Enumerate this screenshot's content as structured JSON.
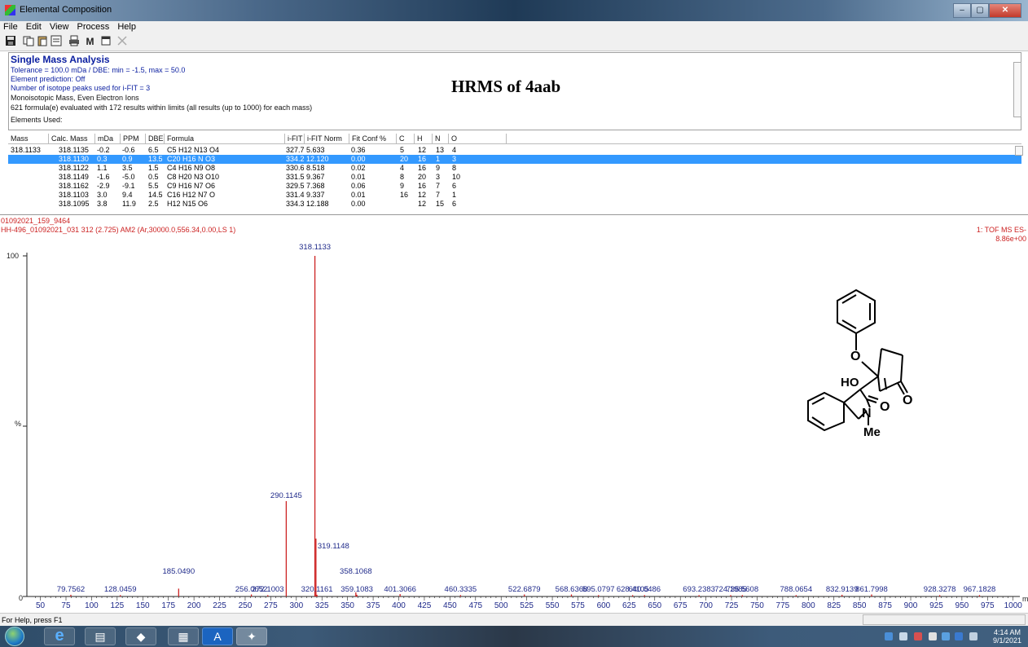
{
  "window": {
    "title": "Elemental Composition",
    "buttons": {
      "minimize": "–",
      "maximize": "▢",
      "close": "✕"
    }
  },
  "menu": [
    "File",
    "Edit",
    "View",
    "Process",
    "Help"
  ],
  "toolbar": {
    "m_label": "M"
  },
  "summary": {
    "title": "Single Mass Analysis",
    "tolerance": "Tolerance = 100.0 mDa  /  DBE: min = -1.5, max = 50.0",
    "element_prediction": "Element prediction: Off",
    "isotope_peaks": "Number of isotope peaks used for i-FIT = 3",
    "ion_type": "Monoisotopic Mass, Even Electron Ions",
    "formula_count": "621 formula(e) evaluated with 172 results within limits (all results (up to 1000) for each mass)",
    "elements_used": "Elements Used:",
    "annotation": "HRMS of 4aab"
  },
  "results": {
    "columns": [
      "Mass",
      "Calc. Mass",
      "mDa",
      "PPM",
      "DBE",
      "Formula",
      "i-FIT",
      "i-FIT Norm",
      "Fit Conf %",
      "C",
      "H",
      "N",
      "O"
    ],
    "rows": [
      {
        "mass": "318.1133",
        "calc": "318.1135",
        "mda": "-0.2",
        "ppm": "-0.6",
        "dbe": "6.5",
        "formula": "C5 H12 N13 O4",
        "ifit": "327.7",
        "ifitnorm": "5.633",
        "conf": "0.36",
        "c": "5",
        "h": "12",
        "n": "13",
        "o": "4"
      },
      {
        "mass": "",
        "calc": "318.1130",
        "mda": "0.3",
        "ppm": "0.9",
        "dbe": "13.5",
        "formula": "C20 H16 N O3",
        "ifit": "334.2",
        "ifitnorm": "12.120",
        "conf": "0.00",
        "c": "20",
        "h": "16",
        "n": "1",
        "o": "3"
      },
      {
        "mass": "",
        "calc": "318.1122",
        "mda": "1.1",
        "ppm": "3.5",
        "dbe": "1.5",
        "formula": "C4 H16 N9 O8",
        "ifit": "330.6",
        "ifitnorm": "8.518",
        "conf": "0.02",
        "c": "4",
        "h": "16",
        "n": "9",
        "o": "8"
      },
      {
        "mass": "",
        "calc": "318.1149",
        "mda": "-1.6",
        "ppm": "-5.0",
        "dbe": "0.5",
        "formula": "C8 H20 N3 O10",
        "ifit": "331.5",
        "ifitnorm": "9.367",
        "conf": "0.01",
        "c": "8",
        "h": "20",
        "n": "3",
        "o": "10"
      },
      {
        "mass": "",
        "calc": "318.1162",
        "mda": "-2.9",
        "ppm": "-9.1",
        "dbe": "5.5",
        "formula": "C9 H16 N7 O6",
        "ifit": "329.5",
        "ifitnorm": "7.368",
        "conf": "0.06",
        "c": "9",
        "h": "16",
        "n": "7",
        "o": "6"
      },
      {
        "mass": "",
        "calc": "318.1103",
        "mda": "3.0",
        "ppm": "9.4",
        "dbe": "14.5",
        "formula": "C16 H12 N7 O",
        "ifit": "331.4",
        "ifitnorm": "9.337",
        "conf": "0.01",
        "c": "16",
        "h": "12",
        "n": "7",
        "o": "1"
      },
      {
        "mass": "",
        "calc": "318.1095",
        "mda": "3.8",
        "ppm": "11.9",
        "dbe": "2.5",
        "formula": "H12 N15 O6",
        "ifit": "334.3",
        "ifitnorm": "12.188",
        "conf": "0.00",
        "c": "",
        "h": "12",
        "n": "15",
        "o": "6"
      }
    ],
    "selected_row": 1
  },
  "spectrum_header": {
    "sample_id": "01092021_159_9464",
    "scan_info": "HH-496_01092021_031 312 (2.725) AM2 (Ar,30000.0,556.34,0.00,LS 1)",
    "mode": "1: TOF MS ES-",
    "intensity": "8.86e+00",
    "y_top_label": "100",
    "y_mid_label": "%",
    "y_zero_label": "0",
    "x_unit": "m"
  },
  "chart_data": {
    "type": "bar",
    "xlim": [
      40,
      1005
    ],
    "ylim": [
      0,
      100
    ],
    "x_ticks": [
      50,
      75,
      100,
      125,
      150,
      175,
      200,
      225,
      250,
      275,
      300,
      325,
      350,
      375,
      400,
      425,
      450,
      475,
      500,
      525,
      550,
      575,
      600,
      625,
      650,
      675,
      700,
      725,
      750,
      775,
      800,
      825,
      850,
      875,
      900,
      925,
      950,
      975,
      1000
    ],
    "peaks": [
      {
        "mz": 79.7562,
        "label": "79.7562",
        "rel": 0.5
      },
      {
        "mz": 128.0459,
        "label": "128.0459",
        "rel": 0.4
      },
      {
        "mz": 185.049,
        "label": "185.0490",
        "rel": 2.3
      },
      {
        "mz": 256.0652,
        "label": "256.0652",
        "rel": 0.6
      },
      {
        "mz": 272.1003,
        "label": "272.1003",
        "rel": 0.4
      },
      {
        "mz": 290.1145,
        "label": "290.1145",
        "rel": 28
      },
      {
        "mz": 318.1133,
        "label": "318.1133",
        "rel": 100
      },
      {
        "mz": 319.1148,
        "label": "319.1148",
        "rel": 17
      },
      {
        "mz": 320.1161,
        "label": "320.1161",
        "rel": 0.5
      },
      {
        "mz": 358.1068,
        "label": "358.1068",
        "rel": 1.2
      },
      {
        "mz": 359.1083,
        "label": "359.1083",
        "rel": 0.5
      },
      {
        "mz": 401.3066,
        "label": "401.3066",
        "rel": 0.7
      },
      {
        "mz": 460.3335,
        "label": "460.3335",
        "rel": 0.4
      },
      {
        "mz": 522.6879,
        "label": "522.6879",
        "rel": 0.6
      },
      {
        "mz": 568.6368,
        "label": "568.6368",
        "rel": 0.6
      },
      {
        "mz": 595.0797,
        "label": "595.0797",
        "rel": 0.4
      },
      {
        "mz": 628.4105,
        "label": "628.4105",
        "rel": 0.4
      },
      {
        "mz": 640.0486,
        "label": "640.0486",
        "rel": 0.4
      },
      {
        "mz": 693.2383,
        "label": "693.2383",
        "rel": 0.4
      },
      {
        "mz": 724.1985,
        "label": "724.1985",
        "rel": 0.4
      },
      {
        "mz": 735.5608,
        "label": "735.5608",
        "rel": 0.4
      },
      {
        "mz": 788.0654,
        "label": "788.0654",
        "rel": 0.4
      },
      {
        "mz": 832.9139,
        "label": "832.9139",
        "rel": 0.5
      },
      {
        "mz": 861.7998,
        "label": "861.7998",
        "rel": 0.6
      },
      {
        "mz": 928.3278,
        "label": "928.3278",
        "rel": 0.4
      },
      {
        "mz": 967.1828,
        "label": "967.1828",
        "rel": 0.4
      }
    ]
  },
  "structure": {
    "atoms": {
      "o_ether": "O",
      "ho": "HO",
      "o_ketone": "O",
      "o_lactam": "O",
      "n": "N",
      "me": "Me"
    }
  },
  "status": {
    "help": "For Help, press F1"
  },
  "taskbar": {
    "time": "4:14 AM",
    "date": "9/1/2021",
    "app_a_label": "A"
  },
  "colors": {
    "spectrum": "#cc2222",
    "peak_label": "#1f2a8a",
    "selection": "#3399ff"
  }
}
